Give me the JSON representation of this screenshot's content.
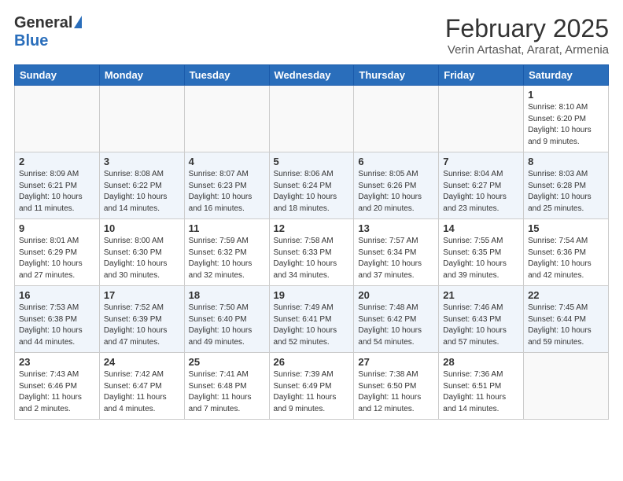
{
  "header": {
    "logo_general": "General",
    "logo_blue": "Blue",
    "month": "February 2025",
    "location": "Verin Artashat, Ararat, Armenia"
  },
  "days_of_week": [
    "Sunday",
    "Monday",
    "Tuesday",
    "Wednesday",
    "Thursday",
    "Friday",
    "Saturday"
  ],
  "weeks": [
    [
      {
        "day": "",
        "info": ""
      },
      {
        "day": "",
        "info": ""
      },
      {
        "day": "",
        "info": ""
      },
      {
        "day": "",
        "info": ""
      },
      {
        "day": "",
        "info": ""
      },
      {
        "day": "",
        "info": ""
      },
      {
        "day": "1",
        "info": "Sunrise: 8:10 AM\nSunset: 6:20 PM\nDaylight: 10 hours\nand 9 minutes."
      }
    ],
    [
      {
        "day": "2",
        "info": "Sunrise: 8:09 AM\nSunset: 6:21 PM\nDaylight: 10 hours\nand 11 minutes."
      },
      {
        "day": "3",
        "info": "Sunrise: 8:08 AM\nSunset: 6:22 PM\nDaylight: 10 hours\nand 14 minutes."
      },
      {
        "day": "4",
        "info": "Sunrise: 8:07 AM\nSunset: 6:23 PM\nDaylight: 10 hours\nand 16 minutes."
      },
      {
        "day": "5",
        "info": "Sunrise: 8:06 AM\nSunset: 6:24 PM\nDaylight: 10 hours\nand 18 minutes."
      },
      {
        "day": "6",
        "info": "Sunrise: 8:05 AM\nSunset: 6:26 PM\nDaylight: 10 hours\nand 20 minutes."
      },
      {
        "day": "7",
        "info": "Sunrise: 8:04 AM\nSunset: 6:27 PM\nDaylight: 10 hours\nand 23 minutes."
      },
      {
        "day": "8",
        "info": "Sunrise: 8:03 AM\nSunset: 6:28 PM\nDaylight: 10 hours\nand 25 minutes."
      }
    ],
    [
      {
        "day": "9",
        "info": "Sunrise: 8:01 AM\nSunset: 6:29 PM\nDaylight: 10 hours\nand 27 minutes."
      },
      {
        "day": "10",
        "info": "Sunrise: 8:00 AM\nSunset: 6:30 PM\nDaylight: 10 hours\nand 30 minutes."
      },
      {
        "day": "11",
        "info": "Sunrise: 7:59 AM\nSunset: 6:32 PM\nDaylight: 10 hours\nand 32 minutes."
      },
      {
        "day": "12",
        "info": "Sunrise: 7:58 AM\nSunset: 6:33 PM\nDaylight: 10 hours\nand 34 minutes."
      },
      {
        "day": "13",
        "info": "Sunrise: 7:57 AM\nSunset: 6:34 PM\nDaylight: 10 hours\nand 37 minutes."
      },
      {
        "day": "14",
        "info": "Sunrise: 7:55 AM\nSunset: 6:35 PM\nDaylight: 10 hours\nand 39 minutes."
      },
      {
        "day": "15",
        "info": "Sunrise: 7:54 AM\nSunset: 6:36 PM\nDaylight: 10 hours\nand 42 minutes."
      }
    ],
    [
      {
        "day": "16",
        "info": "Sunrise: 7:53 AM\nSunset: 6:38 PM\nDaylight: 10 hours\nand 44 minutes."
      },
      {
        "day": "17",
        "info": "Sunrise: 7:52 AM\nSunset: 6:39 PM\nDaylight: 10 hours\nand 47 minutes."
      },
      {
        "day": "18",
        "info": "Sunrise: 7:50 AM\nSunset: 6:40 PM\nDaylight: 10 hours\nand 49 minutes."
      },
      {
        "day": "19",
        "info": "Sunrise: 7:49 AM\nSunset: 6:41 PM\nDaylight: 10 hours\nand 52 minutes."
      },
      {
        "day": "20",
        "info": "Sunrise: 7:48 AM\nSunset: 6:42 PM\nDaylight: 10 hours\nand 54 minutes."
      },
      {
        "day": "21",
        "info": "Sunrise: 7:46 AM\nSunset: 6:43 PM\nDaylight: 10 hours\nand 57 minutes."
      },
      {
        "day": "22",
        "info": "Sunrise: 7:45 AM\nSunset: 6:44 PM\nDaylight: 10 hours\nand 59 minutes."
      }
    ],
    [
      {
        "day": "23",
        "info": "Sunrise: 7:43 AM\nSunset: 6:46 PM\nDaylight: 11 hours\nand 2 minutes."
      },
      {
        "day": "24",
        "info": "Sunrise: 7:42 AM\nSunset: 6:47 PM\nDaylight: 11 hours\nand 4 minutes."
      },
      {
        "day": "25",
        "info": "Sunrise: 7:41 AM\nSunset: 6:48 PM\nDaylight: 11 hours\nand 7 minutes."
      },
      {
        "day": "26",
        "info": "Sunrise: 7:39 AM\nSunset: 6:49 PM\nDaylight: 11 hours\nand 9 minutes."
      },
      {
        "day": "27",
        "info": "Sunrise: 7:38 AM\nSunset: 6:50 PM\nDaylight: 11 hours\nand 12 minutes."
      },
      {
        "day": "28",
        "info": "Sunrise: 7:36 AM\nSunset: 6:51 PM\nDaylight: 11 hours\nand 14 minutes."
      },
      {
        "day": "",
        "info": ""
      }
    ]
  ]
}
